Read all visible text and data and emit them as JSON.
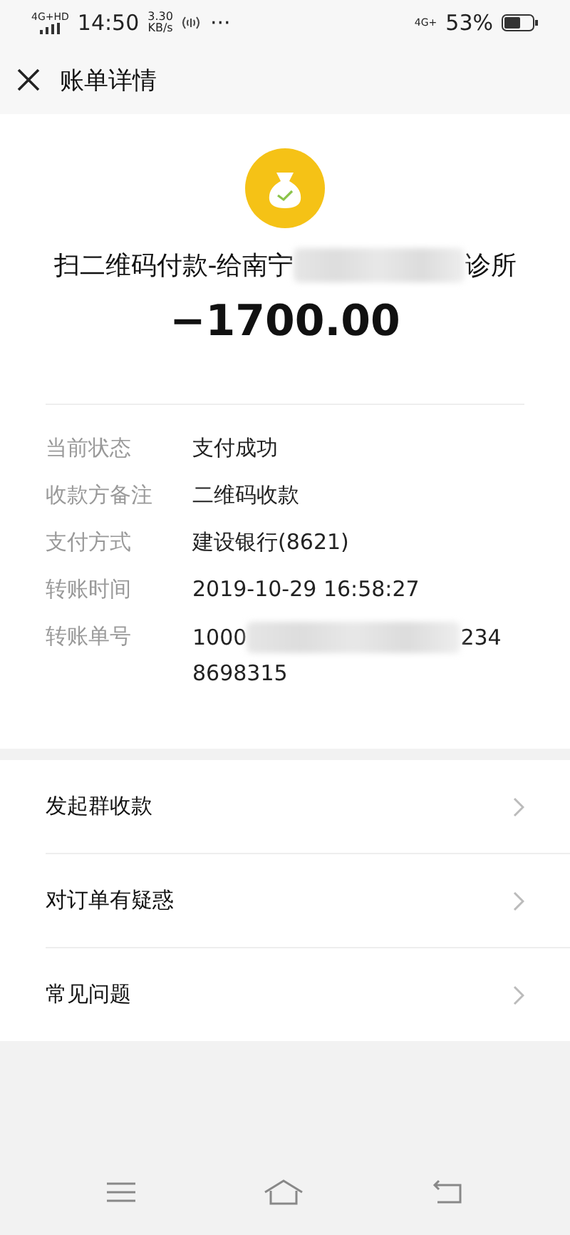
{
  "status_bar": {
    "network": "4G+HD",
    "time": "14:50",
    "speed_value": "3.30",
    "speed_unit": "KB/s",
    "dots": "···",
    "network_right": "4G+",
    "battery": "53%"
  },
  "header": {
    "title": "账单详情"
  },
  "summary": {
    "title_start": "扫二维码付款-给南宁",
    "title_end": "诊所",
    "amount": "−1700.00"
  },
  "details": [
    {
      "label": "当前状态",
      "value_parts": [
        "支付成功"
      ]
    },
    {
      "label": "收款方备注",
      "value_parts": [
        "二维码收款"
      ]
    },
    {
      "label": "支付方式",
      "value_parts": [
        "建设银行(8621)"
      ]
    },
    {
      "label": "转账时间",
      "value_parts": [
        "2019-10-29 16:58:27"
      ]
    },
    {
      "label": "转账单号",
      "value_parts": [
        "1000",
        "234"
      ],
      "value_second_line": "8698315"
    }
  ],
  "menu": [
    {
      "label": "发起群收款"
    },
    {
      "label": "对订单有疑惑"
    },
    {
      "label": "常见问题"
    }
  ]
}
